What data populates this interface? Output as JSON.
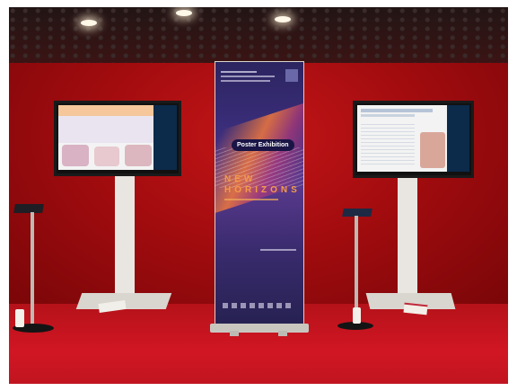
{
  "scene": "Poster exhibition area with two digital display stands and a central roll-up banner",
  "banner": {
    "pill_label": "Poster Exhibition",
    "logo_line1": "NEW",
    "logo_line2": "HORIZONS",
    "colors": {
      "background": "#2f2766",
      "accent": "#f39a4a",
      "pill": "#1a1546"
    }
  },
  "left_display": {
    "content": "poster"
  },
  "right_display": {
    "content": "poster"
  }
}
